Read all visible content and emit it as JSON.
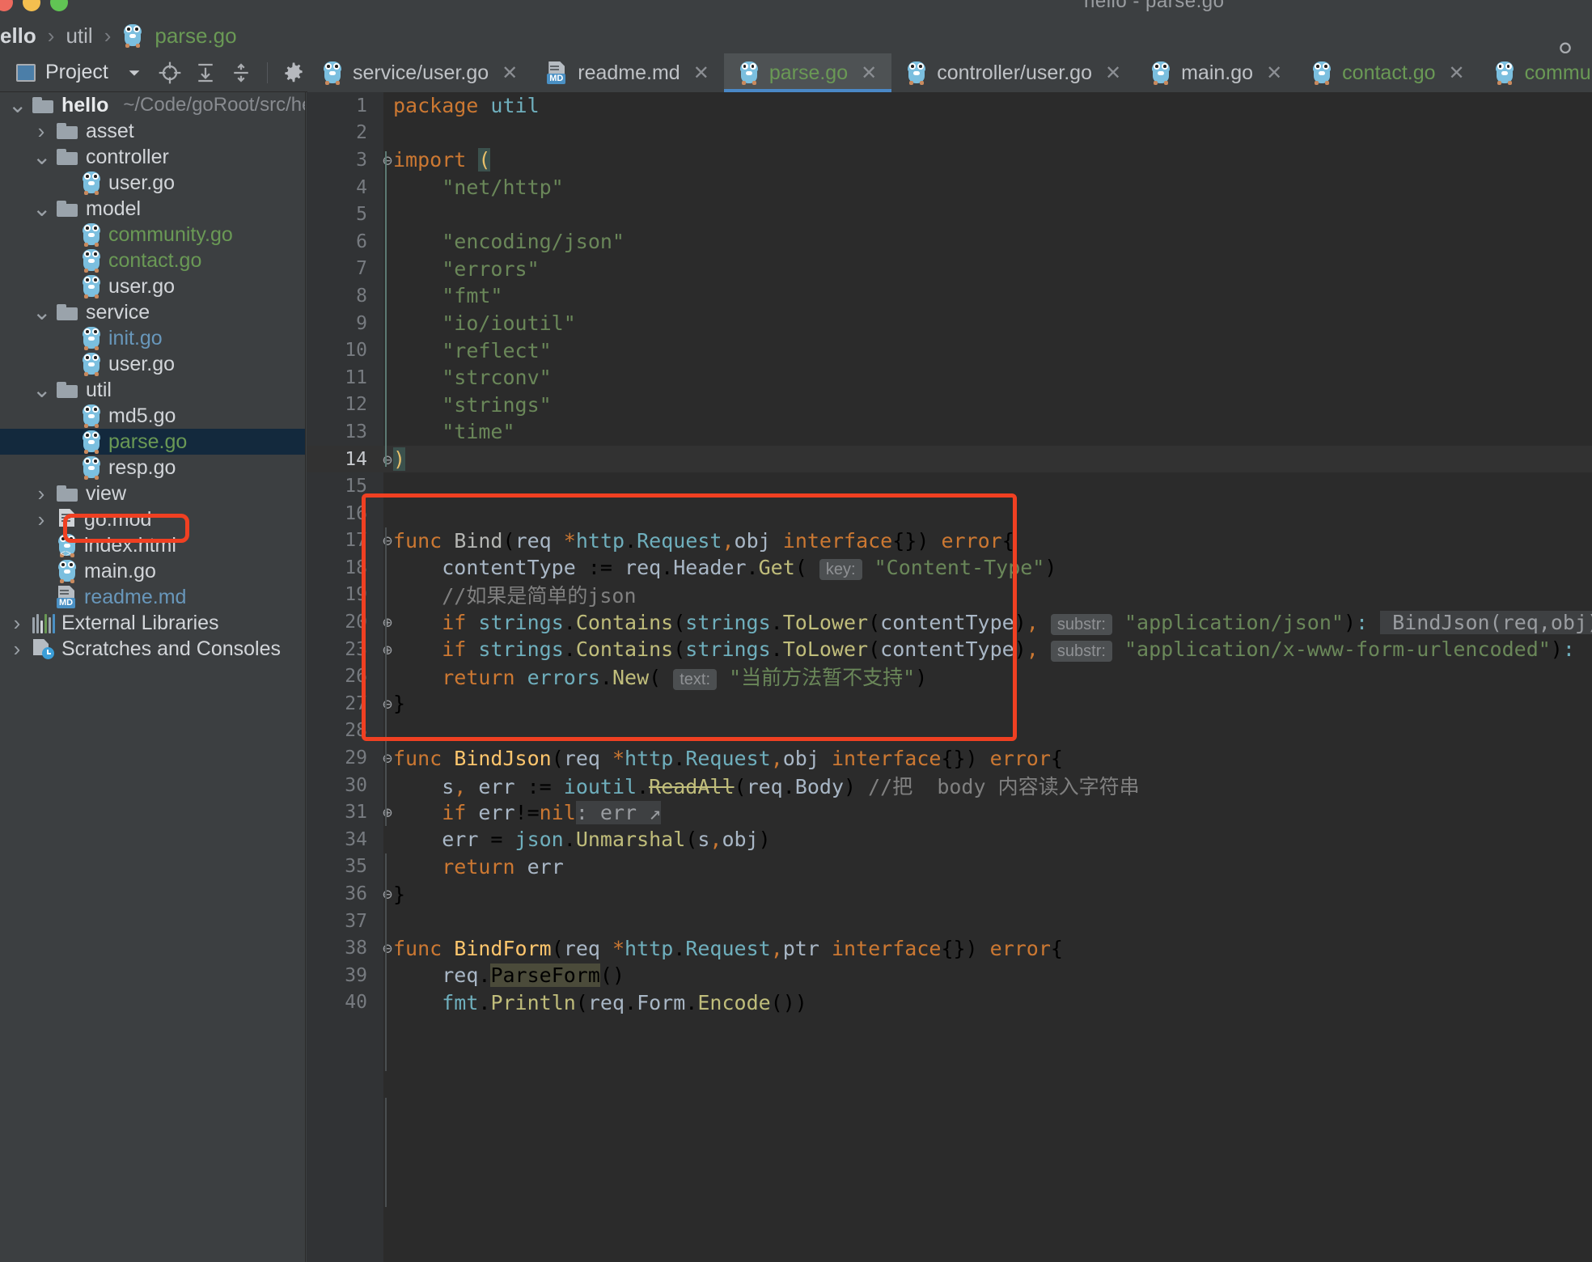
{
  "window": {
    "title": "hello - parse.go"
  },
  "breadcrumb": {
    "items": [
      {
        "label": "ello",
        "type": "project"
      },
      {
        "label": "util",
        "type": "folder"
      },
      {
        "label": "parse.go",
        "type": "gofile"
      }
    ],
    "separator": "›"
  },
  "toolbar": {
    "project_label": "Project",
    "icons": [
      "chevron-down-icon",
      "locate-icon",
      "expand-all-icon",
      "collapse-all-icon",
      "gear-icon",
      "minimize-icon"
    ]
  },
  "tabs": [
    {
      "label": "service/user.go",
      "icon": "go-icon",
      "color": "default",
      "active": false,
      "close": "✕"
    },
    {
      "label": "readme.md",
      "icon": "md-icon",
      "color": "default",
      "active": false,
      "close": "✕"
    },
    {
      "label": "parse.go",
      "icon": "go-icon",
      "color": "green",
      "active": true,
      "close": "✕"
    },
    {
      "label": "controller/user.go",
      "icon": "go-icon",
      "color": "default",
      "active": false,
      "close": "✕"
    },
    {
      "label": "main.go",
      "icon": "go-icon",
      "color": "default",
      "active": false,
      "close": "✕"
    },
    {
      "label": "contact.go",
      "icon": "go-icon",
      "color": "green",
      "active": false,
      "close": "✕"
    },
    {
      "label": "commu",
      "icon": "go-icon",
      "color": "green",
      "active": false,
      "close": ""
    }
  ],
  "sidebar": {
    "tree": [
      {
        "label": "hello",
        "suffix": "~/Code/goRoot/src/hello",
        "icon": "folder-icon",
        "arrow": "down",
        "indent": 0,
        "style": "bold"
      },
      {
        "label": "asset",
        "icon": "folder-icon",
        "arrow": "right",
        "indent": 1,
        "style": "normal"
      },
      {
        "label": "controller",
        "icon": "folder-icon",
        "arrow": "down",
        "indent": 1,
        "style": "normal"
      },
      {
        "label": "user.go",
        "icon": "go-icon",
        "arrow": "none",
        "indent": 2,
        "style": "normal"
      },
      {
        "label": "model",
        "icon": "folder-icon",
        "arrow": "down",
        "indent": 1,
        "style": "normal"
      },
      {
        "label": "community.go",
        "icon": "go-icon",
        "arrow": "none",
        "indent": 2,
        "style": "green"
      },
      {
        "label": "contact.go",
        "icon": "go-icon",
        "arrow": "none",
        "indent": 2,
        "style": "green"
      },
      {
        "label": "user.go",
        "icon": "go-icon",
        "arrow": "none",
        "indent": 2,
        "style": "normal"
      },
      {
        "label": "service",
        "icon": "folder-icon",
        "arrow": "down",
        "indent": 1,
        "style": "normal"
      },
      {
        "label": "init.go",
        "icon": "go-icon",
        "arrow": "none",
        "indent": 2,
        "style": "blue"
      },
      {
        "label": "user.go",
        "icon": "go-icon",
        "arrow": "none",
        "indent": 2,
        "style": "normal"
      },
      {
        "label": "util",
        "icon": "folder-icon",
        "arrow": "down",
        "indent": 1,
        "style": "normal"
      },
      {
        "label": "md5.go",
        "icon": "go-icon",
        "arrow": "none",
        "indent": 2,
        "style": "normal"
      },
      {
        "label": "parse.go",
        "icon": "go-icon",
        "arrow": "none",
        "indent": 2,
        "style": "green",
        "selected": true
      },
      {
        "label": "resp.go",
        "icon": "go-icon",
        "arrow": "none",
        "indent": 2,
        "style": "normal"
      },
      {
        "label": "view",
        "icon": "folder-icon",
        "arrow": "right",
        "indent": 1,
        "style": "normal"
      },
      {
        "label": "go.mod",
        "icon": "mod-icon",
        "arrow": "right",
        "indent": 1,
        "style": "normal"
      },
      {
        "label": "index.html",
        "icon": "html-icon",
        "arrow": "none",
        "indent": 1,
        "style": "normal"
      },
      {
        "label": "main.go",
        "icon": "go-icon",
        "arrow": "none",
        "indent": 1,
        "style": "normal"
      },
      {
        "label": "readme.md",
        "icon": "md-icon",
        "arrow": "none",
        "indent": 1,
        "style": "blue"
      },
      {
        "label": "External Libraries",
        "icon": "library-icon",
        "arrow": "right",
        "indent": 0,
        "style": "normal"
      },
      {
        "label": "Scratches and Consoles",
        "icon": "scratches-icon",
        "arrow": "right",
        "indent": 0,
        "style": "normal"
      }
    ]
  },
  "editor": {
    "file": "parse.go",
    "lines": [
      {
        "num": "1",
        "fold": "",
        "current": false,
        "html": "<span class='kw'>package</span> <span class='typ'>util</span>"
      },
      {
        "num": "2",
        "fold": "",
        "current": false,
        "html": ""
      },
      {
        "num": "3",
        "fold": "⊖",
        "current": false,
        "html": "<span class='kw'>import</span> <span class='ylw brhl'>(</span>"
      },
      {
        "num": "4",
        "fold": "",
        "current": false,
        "html": "    <span class='str'>\"net/http\"</span>"
      },
      {
        "num": "5",
        "fold": "",
        "current": false,
        "html": ""
      },
      {
        "num": "6",
        "fold": "",
        "current": false,
        "html": "    <span class='str'>\"encoding/json\"</span>"
      },
      {
        "num": "7",
        "fold": "",
        "current": false,
        "html": "    <span class='str'>\"errors\"</span>"
      },
      {
        "num": "8",
        "fold": "",
        "current": false,
        "html": "    <span class='str'>\"fmt\"</span>"
      },
      {
        "num": "9",
        "fold": "",
        "current": false,
        "html": "    <span class='str'>\"io/ioutil\"</span>"
      },
      {
        "num": "10",
        "fold": "",
        "current": false,
        "html": "    <span class='str'>\"reflect\"</span>"
      },
      {
        "num": "11",
        "fold": "",
        "current": false,
        "html": "    <span class='str'>\"strconv\"</span>"
      },
      {
        "num": "12",
        "fold": "",
        "current": false,
        "html": "    <span class='str'>\"strings\"</span>"
      },
      {
        "num": "13",
        "fold": "",
        "current": false,
        "html": "    <span class='str'>\"time\"</span>"
      },
      {
        "num": "14",
        "fold": "⊖",
        "current": true,
        "html": "<span class='ylw brhl'>)</span>"
      },
      {
        "num": "15",
        "fold": "",
        "current": false,
        "html": ""
      },
      {
        "num": "16",
        "fold": "",
        "current": false,
        "html": ""
      },
      {
        "num": "17",
        "fold": "⊖",
        "current": false,
        "html": "<span class='kw'>func</span> <span class='fnm'>Bind</span>(<span class='pl'>req</span> <span class='kw'>*</span><span class='typ'>http</span>.<span class='typ'>Request</span><span class='kw'>,</span><span class='pl'>obj</span> <span class='kw'>interface</span>{}) <span class='kw'>error</span>{"
      },
      {
        "num": "18",
        "fold": "",
        "current": false,
        "html": "    <span class='pl'>contentType</span> := <span class='pl'>req</span>.<span class='pl'>Header</span>.<span class='mcall'>Get</span>( <span class='hintbg'>key:</span> <span class='str'>\"Content-Type\"</span>)"
      },
      {
        "num": "19",
        "fold": "",
        "current": false,
        "html": "    <span class='cm'>//如果是简单的json</span>"
      },
      {
        "num": "20",
        "fold": "⊕",
        "current": false,
        "html": "    <span class='kw'>if</span> <span class='typ'>strings</span>.<span class='mcall'>Contains</span>(<span class='typ'>strings</span>.<span class='mcall'>ToLower</span>(<span class='pl'>contentType</span>)<span class='kw'>,</span> <span class='hintbg'>substr:</span> <span class='str'>\"application/json\"</span>)<span class='typ'>:</span> <span class='inlinehint'> BindJson(req,obj) </span>"
      },
      {
        "num": "23",
        "fold": "⊕",
        "current": false,
        "html": "    <span class='kw'>if</span> <span class='typ'>strings</span>.<span class='mcall'>Contains</span>(<span class='typ'>strings</span>.<span class='mcall'>ToLower</span>(<span class='pl'>contentType</span>)<span class='kw'>,</span> <span class='hintbg'>substr:</span> <span class='str'>\"application/x-www-form-urlencoded\"</span>)<span class='typ'>:</span>"
      },
      {
        "num": "26",
        "fold": "",
        "current": false,
        "html": "    <span class='kw'>return</span> <span class='typ'>errors</span>.<span class='mcall'>New</span>( <span class='hintbg'>text:</span> <span class='str'>\"当前方法暂不支持\"</span>)"
      },
      {
        "num": "27",
        "fold": "⊖",
        "current": false,
        "html": "}"
      },
      {
        "num": "28",
        "fold": "",
        "current": false,
        "html": ""
      },
      {
        "num": "29",
        "fold": "⊖",
        "current": false,
        "html": "<span class='kw'>func</span> <span class='fn'>BindJson</span>(<span class='pl'>req</span> <span class='kw'>*</span><span class='typ'>http</span>.<span class='typ'>Request</span><span class='kw'>,</span><span class='pl'>obj</span> <span class='kw'>interface</span>{}) <span class='kw'>error</span>{"
      },
      {
        "num": "30",
        "fold": "",
        "current": false,
        "html": "    <span class='pl'>s</span><span class='kw'>,</span> <span class='pl'>err</span> := <span class='typ'>ioutil</span>.<span class='mcall strike'>ReadAll</span>(<span class='pl'>req</span>.<span class='pl'>Body</span>) <span class='cm'>//把  body 内容读入字符串</span>"
      },
      {
        "num": "31",
        "fold": "⊕",
        "current": false,
        "html": "    <span class='kw'>if</span> <span class='pl'>err</span>!=<span class='kw'>nil</span><span class='inlinehint'>: err ↗</span>"
      },
      {
        "num": "34",
        "fold": "",
        "current": false,
        "html": "    <span class='pl'>err</span> = <span class='typ'>json</span>.<span class='mcall'>Unmarshal</span>(<span class='pl'>s</span><span class='kw'>,</span><span class='pl'>obj</span>)"
      },
      {
        "num": "35",
        "fold": "",
        "current": false,
        "html": "    <span class='kw'>return</span> <span class='pl'>err</span>"
      },
      {
        "num": "36",
        "fold": "⊖",
        "current": false,
        "html": "}"
      },
      {
        "num": "37",
        "fold": "",
        "current": false,
        "html": ""
      },
      {
        "num": "38",
        "fold": "⊖",
        "current": false,
        "html": "<span class='kw'>func</span> <span class='fn'>BindForm</span>(<span class='pl'>req</span> <span class='kw'>*</span><span class='typ'>http</span>.<span class='typ'>Request</span><span class='kw'>,</span><span class='pl'>ptr</span> <span class='kw'>interface</span>{}) <span class='kw'>error</span>{"
      },
      {
        "num": "39",
        "fold": "",
        "current": false,
        "html": "    <span class='pl'>req</span>.<span class='usagehl'>ParseForm</span>()"
      },
      {
        "num": "40",
        "fold": "",
        "current": false,
        "html": "    <span class='typ'>fmt</span>.<span class='mcall'>Println</span>(<span class='pl'>req</span>.<span class='pl'>Form</span>.<span class='mcall'>Encode</span>())"
      }
    ]
  },
  "annotations": {
    "sidebar_highlight_target": "parse.go",
    "editor_highlight_target": "Bind function block",
    "color": "#f04022"
  }
}
